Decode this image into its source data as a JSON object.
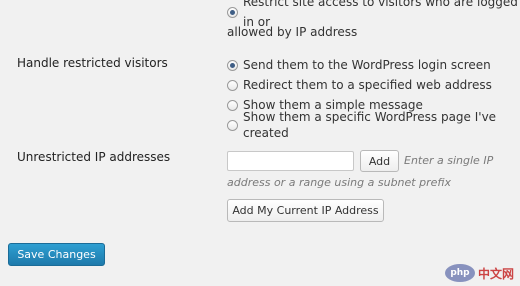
{
  "top_option": {
    "line1": "Restrict site access to visitors who are logged in or",
    "line2": "allowed by IP address"
  },
  "handle": {
    "label": "Handle restricted visitors",
    "options": [
      "Send them to the WordPress login screen",
      "Redirect them to a specified web address",
      "Show them a simple message",
      "Show them a specific WordPress page I've created"
    ],
    "selected_index": 0
  },
  "ip": {
    "label": "Unrestricted IP addresses",
    "input_value": "",
    "add_label": "Add",
    "hint_line1": "Enter a single IP",
    "hint_line2": "address or a range using a subnet prefix",
    "add_current_label": "Add My Current IP Address"
  },
  "save_label": "Save Changes",
  "watermark": {
    "php": "php",
    "text": "中文网"
  },
  "colors": {
    "primary_button": "#2183b8",
    "background": "#f1f1f1"
  }
}
